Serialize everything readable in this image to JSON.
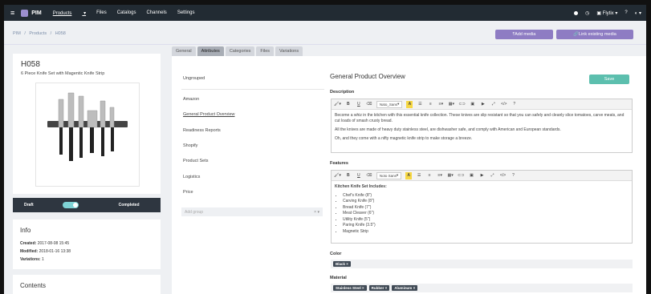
{
  "topbar": {
    "menu_icon": "hamburger-icon",
    "logo": "PIM",
    "nav": [
      "Products",
      "Files",
      "Catalogs",
      "Channels",
      "Settings"
    ],
    "user": "Flytix",
    "colors": {
      "topbar": "#222b33",
      "accent": "#8e7cc3"
    }
  },
  "breadcrumb": [
    "PIM",
    "/",
    "Products",
    "/",
    "H058"
  ],
  "actions": {
    "add_media": "Add media",
    "link_media": "Link existing media"
  },
  "product": {
    "sku": "H058",
    "name": "6 Piece Knife Set with Magentic Knife Strip"
  },
  "status": {
    "left": "Draft",
    "right": "Completed"
  },
  "info": {
    "title": "Info",
    "created_label": "Created:",
    "created": "2017-08-08 15:45",
    "modified_label": "Modified:",
    "modified": "2018-01-16 13:38",
    "variations_label": "Variations:",
    "variations": "1"
  },
  "contents": {
    "title": "Contents"
  },
  "tabs": [
    "General",
    "Attributes",
    "Categories",
    "Files",
    "Variations"
  ],
  "groups": [
    "Ungrouped",
    "Amazon",
    "General Product Overview",
    "Readiness Reports",
    "Shopify",
    "Product Sets",
    "Logistics",
    "Price"
  ],
  "add_group": "Add group",
  "form": {
    "title": "General Product Overview",
    "save": "Save"
  },
  "description": {
    "label": "Description",
    "font": "Nato_Sans",
    "paragraphs": [
      "Become a whiz in the kitchen with this essential knife collection. These knives are slip resistant so that you can safely and cleanly slice tomatoes, carve meats, and cut loads of smash crusty bread.",
      "All the knives are made of heavy duty stainless steel, are dishwasher safe, and comply with American and European standards.",
      "Oh, and they come with a nifty magnetic knife strip to make storage a breeze."
    ]
  },
  "features": {
    "label": "Features",
    "font": "Noto Sans",
    "heading": "Kitchen Knife Set Includes:",
    "items": [
      "Chef's Knife (8\")",
      "Carving Knife (8\")",
      "Bread Knife (7\")",
      "Meat Cleaver (6\")",
      "Utility Knife (5\")",
      "Paring Knife (3.5\")",
      "Magnetic Strip"
    ]
  },
  "color": {
    "label": "Color",
    "tags": [
      "Black"
    ]
  },
  "material": {
    "label": "Material",
    "tags": [
      "Stainless Steel",
      "Rubber",
      "Aluminum"
    ]
  }
}
